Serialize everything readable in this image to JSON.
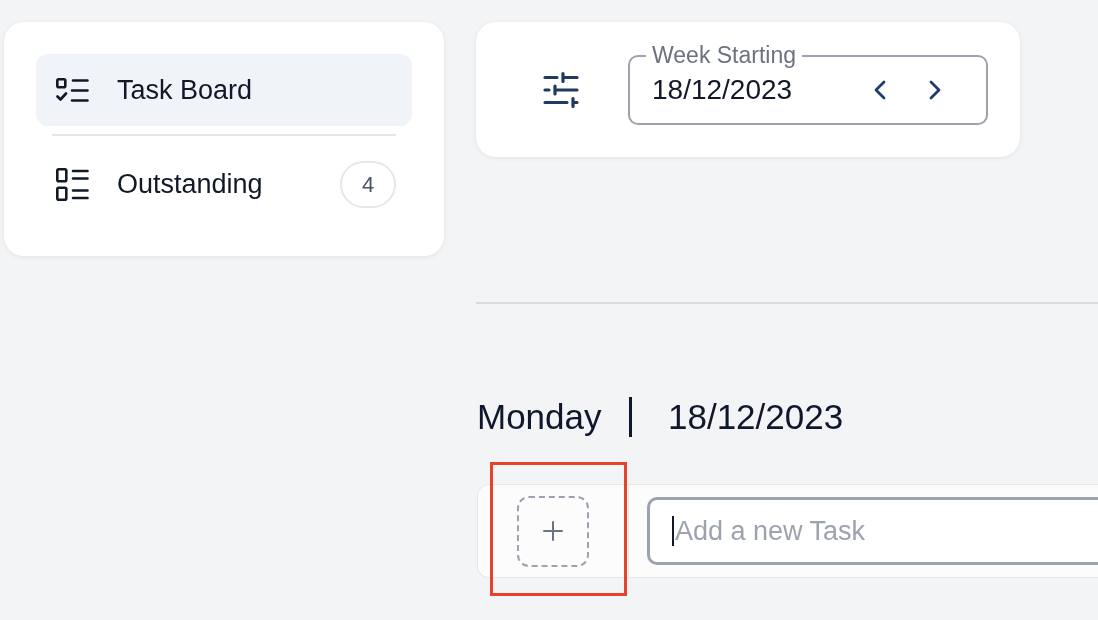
{
  "sidebar": {
    "items": [
      {
        "label": "Task Board",
        "kind": "checklist",
        "selected": true
      },
      {
        "label": "Outstanding",
        "kind": "list",
        "selected": false,
        "count": "4"
      }
    ]
  },
  "toolbar": {
    "week_picker": {
      "label": "Week Starting",
      "value": "18/12/2023"
    }
  },
  "day": {
    "name": "Monday",
    "date": "18/12/2023",
    "add_button": {
      "highlighted": true
    },
    "new_task": {
      "placeholder": "Add a new Task",
      "focused": true
    }
  }
}
